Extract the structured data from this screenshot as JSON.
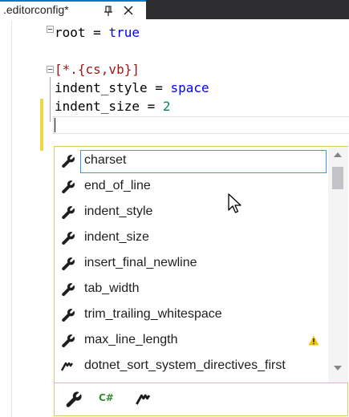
{
  "tab": {
    "title": ".editorconfig*",
    "pin_icon": "pin-icon",
    "close_icon": "close-icon"
  },
  "editor": {
    "lines": [
      {
        "key": "root",
        "op": " = ",
        "value": "true"
      },
      {
        "section": "[*.{cs,vb}]"
      },
      {
        "key": "indent_style",
        "op": " = ",
        "value": "space"
      },
      {
        "key": "indent_size",
        "op": " = ",
        "value": "2"
      }
    ]
  },
  "completion": {
    "selected_index": 0,
    "items": [
      {
        "label": "charset",
        "icon": "wrench-icon",
        "warning": false
      },
      {
        "label": "end_of_line",
        "icon": "wrench-icon",
        "warning": false
      },
      {
        "label": "indent_style",
        "icon": "wrench-icon",
        "warning": false
      },
      {
        "label": "indent_size",
        "icon": "wrench-icon",
        "warning": false
      },
      {
        "label": "insert_final_newline",
        "icon": "wrench-icon",
        "warning": false
      },
      {
        "label": "tab_width",
        "icon": "wrench-icon",
        "warning": false
      },
      {
        "label": "trim_trailing_whitespace",
        "icon": "wrench-icon",
        "warning": false
      },
      {
        "label": "max_line_length",
        "icon": "wrench-icon",
        "warning": true
      },
      {
        "label": "dotnet_sort_system_directives_first",
        "icon": "dotnet-icon",
        "warning": false
      }
    ],
    "filters": {
      "settings_icon": "wrench-icon",
      "csharp_label": "C#",
      "dotnet_icon": "dotnet-icon"
    }
  },
  "colors": {
    "accent": "#007acc",
    "keyword": "#0000ff",
    "section": "#a31515",
    "number": "#098658",
    "popup_border": "#e5c365",
    "change_bar": "#efd846",
    "csharp": "#388a34"
  }
}
